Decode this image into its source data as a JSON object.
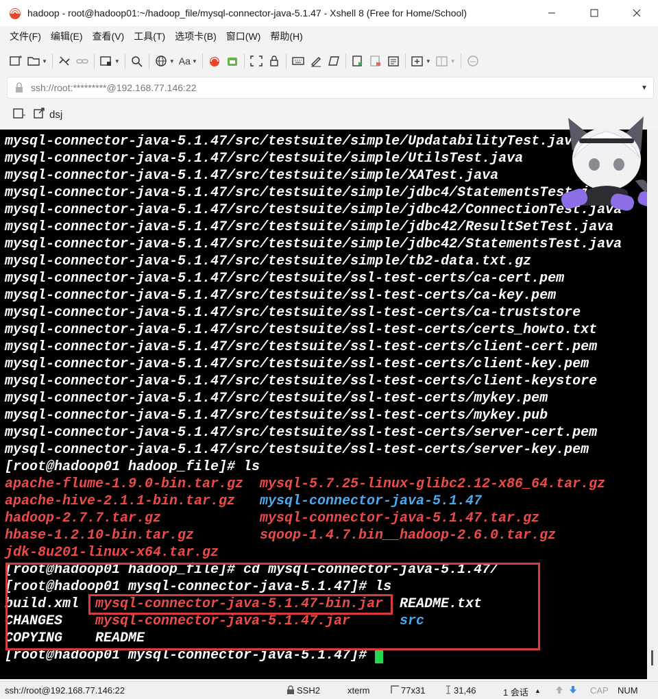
{
  "window": {
    "title": "hadoop - root@hadoop01:~/hadoop_file/mysql-connector-java-5.1.47 - Xshell 8 (Free for Home/School)"
  },
  "menu": [
    "文件(F)",
    "编辑(E)",
    "查看(V)",
    "工具(T)",
    "选项卡(B)",
    "窗口(W)",
    "帮助(H)"
  ],
  "toolbar": {
    "font_label": "Aa"
  },
  "address": {
    "value": "ssh://root:*********@192.168.77.146:22"
  },
  "tab": {
    "label": "dsj"
  },
  "terminal": {
    "lines": [
      "mysql-connector-java-5.1.47/src/testsuite/simple/UpdatabilityTest.java",
      "mysql-connector-java-5.1.47/src/testsuite/simple/UtilsTest.java",
      "mysql-connector-java-5.1.47/src/testsuite/simple/XATest.java",
      "mysql-connector-java-5.1.47/src/testsuite/simple/jdbc4/StatementsTest.java",
      "mysql-connector-java-5.1.47/src/testsuite/simple/jdbc42/ConnectionTest.java",
      "mysql-connector-java-5.1.47/src/testsuite/simple/jdbc42/ResultSetTest.java",
      "mysql-connector-java-5.1.47/src/testsuite/simple/jdbc42/StatementsTest.java",
      "mysql-connector-java-5.1.47/src/testsuite/simple/tb2-data.txt.gz",
      "mysql-connector-java-5.1.47/src/testsuite/ssl-test-certs/ca-cert.pem",
      "mysql-connector-java-5.1.47/src/testsuite/ssl-test-certs/ca-key.pem",
      "mysql-connector-java-5.1.47/src/testsuite/ssl-test-certs/ca-truststore",
      "mysql-connector-java-5.1.47/src/testsuite/ssl-test-certs/certs_howto.txt",
      "mysql-connector-java-5.1.47/src/testsuite/ssl-test-certs/client-cert.pem",
      "mysql-connector-java-5.1.47/src/testsuite/ssl-test-certs/client-key.pem",
      "mysql-connector-java-5.1.47/src/testsuite/ssl-test-certs/client-keystore",
      "mysql-connector-java-5.1.47/src/testsuite/ssl-test-certs/mykey.pem",
      "mysql-connector-java-5.1.47/src/testsuite/ssl-test-certs/mykey.pub",
      "mysql-connector-java-5.1.47/src/testsuite/ssl-test-certs/server-cert.pem",
      "mysql-connector-java-5.1.47/src/testsuite/ssl-test-certs/server-key.pem"
    ],
    "prompt_ls": "[root@hadoop01 hadoop_file]# ls",
    "ls1": {
      "col1": [
        {
          "text": "apache-flume-1.9.0-bin.tar.gz",
          "color": "#ef4a4a"
        },
        {
          "text": "apache-hive-2.1.1-bin.tar.gz",
          "color": "#ef4a4a"
        },
        {
          "text": "hadoop-2.7.7.tar.gz",
          "color": "#ef4a4a"
        },
        {
          "text": "hbase-1.2.10-bin.tar.gz",
          "color": "#ef4a4a"
        },
        {
          "text": "jdk-8u201-linux-x64.tar.gz",
          "color": "#ef4a4a"
        }
      ],
      "col2": [
        {
          "text": "mysql-5.7.25-linux-glibc2.12-x86_64.tar.gz",
          "color": "#ef4a4a"
        },
        {
          "text": "mysql-connector-java-5.1.47",
          "color": "#4aa9ef"
        },
        {
          "text": "mysql-connector-java-5.1.47.tar.gz",
          "color": "#ef4a4a"
        },
        {
          "text": "sqoop-1.4.7.bin__hadoop-2.6.0.tar.gz",
          "color": "#ef4a4a"
        }
      ]
    },
    "prompt_cd": "[root@hadoop01 hadoop_file]# cd mysql-connector-java-5.1.47/",
    "prompt_ls2": "[root@hadoop01 mysql-connector-java-5.1.47]# ls",
    "ls2": {
      "col1": [
        "build.xml",
        "CHANGES",
        "COPYING"
      ],
      "col2": [
        {
          "text": "mysql-connector-java-5.1.47-bin.jar",
          "color": "#ef4a4a"
        },
        {
          "text": "mysql-connector-java-5.1.47.jar",
          "color": "#ef4a4a"
        },
        {
          "text": "README",
          "color": "#ffffff"
        }
      ],
      "col3": [
        {
          "text": "README.txt",
          "color": "#ffffff"
        },
        {
          "text": "src",
          "color": "#4aa9ef"
        }
      ]
    },
    "prompt_final": "[root@hadoop01 mysql-connector-java-5.1.47]# "
  },
  "status": {
    "connection": "ssh://root@192.168.77.146:22",
    "protocol": "SSH2",
    "terminal_type": "xterm",
    "size": "77x31",
    "cursor_pos": "31,46",
    "sessions": "1 会话",
    "cap": "CAP",
    "num": "NUM"
  },
  "colors": {
    "terminal_bg": "#000000",
    "archive_red": "#ef4a4a",
    "directory_blue": "#4aa9ef",
    "cursor_green": "#22d84e",
    "highlight_red": "#d93a3a"
  }
}
